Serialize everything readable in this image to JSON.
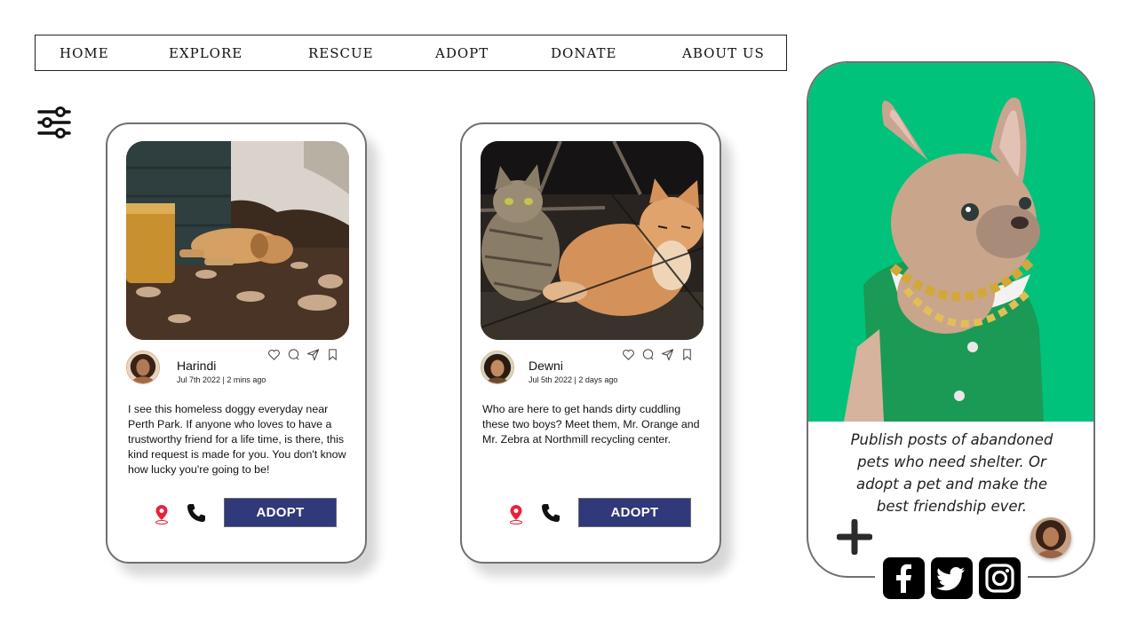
{
  "nav": {
    "items": [
      "HOME",
      "EXPLORE",
      "RESCUE",
      "ADOPT",
      "DONATE",
      "ABOUT US"
    ]
  },
  "posts": [
    {
      "user": "Harindi",
      "meta": "Jul 7th 2022 | 2 mins  ago",
      "text": "I see this homeless doggy everyday near Perth Park. If anyone who loves to have a trustworthy friend for a life time, is there, this kind request is made for you. You don't know how lucky you're going to be!",
      "button": "ADOPT"
    },
    {
      "user": "Dewni",
      "meta": "Jul 5th 2022 | 2 days ago",
      "text": "Who are here to get hands dirty cuddling these two boys? Meet them, Mr. Orange and Mr. Zebra at Northmill recycling center.",
      "button": "ADOPT"
    }
  ],
  "promo": {
    "text": "Publish posts of abandoned pets who need shelter. Or adopt a pet and make the best friendship ever."
  },
  "icons": {
    "filter": "sliders-icon",
    "like": "heart-icon",
    "comment": "comment-icon",
    "share": "send-icon",
    "save": "bookmark-icon",
    "location": "location-pin-icon",
    "call": "phone-icon",
    "add": "plus-icon",
    "social": [
      "facebook-icon",
      "twitter-icon",
      "instagram-icon"
    ]
  },
  "colors": {
    "button": "#30397a",
    "promo_bg": "#00c27a",
    "pin": "#e8213a"
  }
}
